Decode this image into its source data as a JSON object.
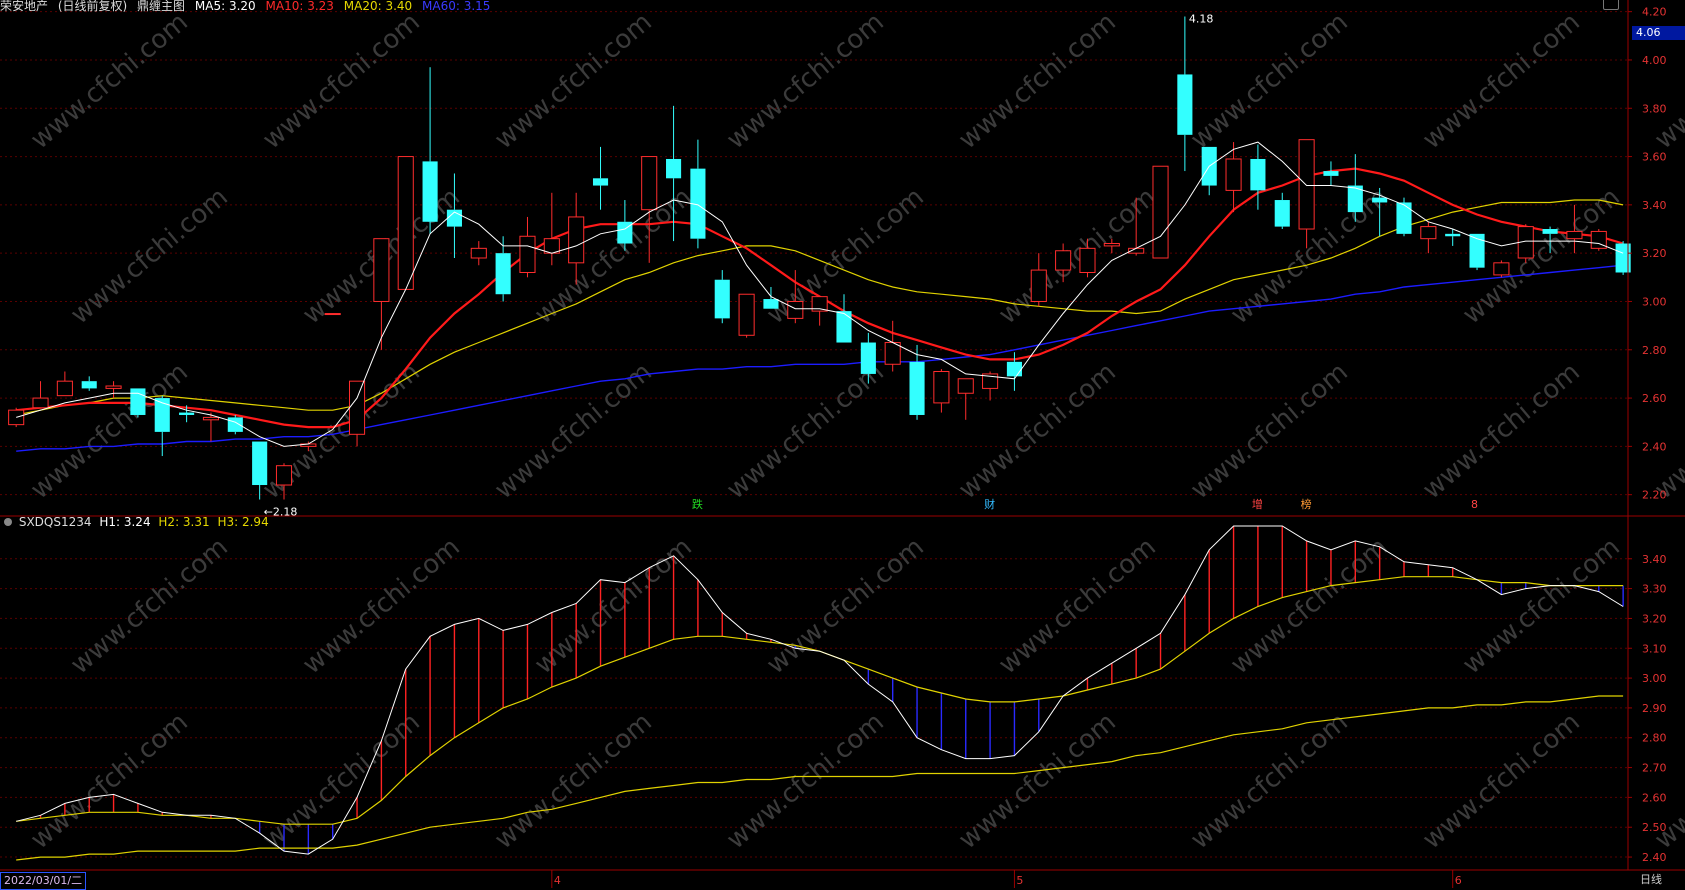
{
  "header": {
    "stock_name": "荣安地产",
    "adjust": "(日线前复权)",
    "indicator_name": "鼎缠主图",
    "ma5": "MA5: 3.20",
    "ma10": "MA10: 3.23",
    "ma20": "MA20: 3.40",
    "ma60": "MA60: 3.15"
  },
  "colors": {
    "up": "#ff2d2d",
    "down": "#33ffff",
    "ma5": "#ffffff",
    "ma10": "#ff1a1a",
    "ma20": "#e0d200",
    "ma60": "#1c1cff",
    "grid": "#5a0000",
    "axis": "#9b0000",
    "axis_text": "#e53333",
    "tag_bg": "#0018a0"
  },
  "price_tag": "4.06",
  "indicator": {
    "name": "SXDQS1234",
    "h1": "H1: 3.24",
    "h2": "H2: 3.31",
    "h3": "H3: 2.94"
  },
  "date_label": "2022/03/01/二",
  "period_label": "日线",
  "watermark": "www.cfchi.com",
  "chart_data": [
    {
      "type": "candlestick",
      "ylim": [
        2.12,
        4.24
      ],
      "yticks": [
        "2.20",
        "2.40",
        "2.60",
        "2.80",
        "3.00",
        "3.20",
        "3.40",
        "3.60",
        "3.80",
        "4.00",
        "4.20"
      ],
      "x_month_ticks": [
        {
          "index": 22,
          "label": "4"
        },
        {
          "index": 41,
          "label": "5"
        },
        {
          "index": 59,
          "label": "6"
        }
      ],
      "annotations": [
        {
          "index": 10,
          "price": 2.18,
          "text": "←2.18"
        },
        {
          "index": 48,
          "price": 4.18,
          "text": "4.18"
        }
      ],
      "event_markers": [
        {
          "index": 28,
          "text": "跌",
          "color": "#22dd22"
        },
        {
          "index": 40,
          "text": "财",
          "color": "#33bbff"
        },
        {
          "index": 51,
          "text": "增",
          "color": "#ff4444"
        },
        {
          "index": 53,
          "text": "榜",
          "color": "#ff9933"
        },
        {
          "index": 60,
          "text": "8",
          "color": "#ff4444"
        }
      ],
      "candles": [
        {
          "o": 2.49,
          "h": 2.56,
          "l": 2.48,
          "c": 2.55
        },
        {
          "o": 2.56,
          "h": 2.67,
          "l": 2.56,
          "c": 2.6
        },
        {
          "o": 2.61,
          "h": 2.71,
          "l": 2.61,
          "c": 2.67
        },
        {
          "o": 2.67,
          "h": 2.69,
          "l": 2.63,
          "c": 2.64
        },
        {
          "o": 2.64,
          "h": 2.67,
          "l": 2.6,
          "c": 2.65
        },
        {
          "o": 2.64,
          "h": 2.64,
          "l": 2.52,
          "c": 2.53
        },
        {
          "o": 2.6,
          "h": 2.61,
          "l": 2.36,
          "c": 2.46
        },
        {
          "o": 2.54,
          "h": 2.57,
          "l": 2.5,
          "c": 2.53
        },
        {
          "o": 2.51,
          "h": 2.54,
          "l": 2.42,
          "c": 2.52
        },
        {
          "o": 2.52,
          "h": 2.53,
          "l": 2.45,
          "c": 2.46
        },
        {
          "o": 2.42,
          "h": 2.42,
          "l": 2.18,
          "c": 2.24
        },
        {
          "o": 2.24,
          "h": 2.33,
          "l": 2.18,
          "c": 2.32
        },
        {
          "o": 2.4,
          "h": 2.42,
          "l": 2.38,
          "c": 2.41
        },
        {
          "o": 2.95,
          "h": 2.95,
          "l": 2.95,
          "c": 2.95
        },
        {
          "o": 2.45,
          "h": 2.67,
          "l": 2.4,
          "c": 2.67
        },
        {
          "o": 3.0,
          "h": 3.26,
          "l": 2.8,
          "c": 3.26
        },
        {
          "o": 3.05,
          "h": 3.6,
          "l": 3.05,
          "c": 3.6
        },
        {
          "o": 3.58,
          "h": 3.97,
          "l": 3.28,
          "c": 3.33
        },
        {
          "o": 3.38,
          "h": 3.53,
          "l": 3.18,
          "c": 3.31
        },
        {
          "o": 3.18,
          "h": 3.25,
          "l": 3.15,
          "c": 3.22
        },
        {
          "o": 3.2,
          "h": 3.27,
          "l": 3.0,
          "c": 3.03
        },
        {
          "o": 3.12,
          "h": 3.35,
          "l": 3.1,
          "c": 3.27
        },
        {
          "o": 3.2,
          "h": 3.45,
          "l": 3.15,
          "c": 3.26
        },
        {
          "o": 3.16,
          "h": 3.45,
          "l": 3.07,
          "c": 3.35
        },
        {
          "o": 3.51,
          "h": 3.64,
          "l": 3.38,
          "c": 3.48
        },
        {
          "o": 3.33,
          "h": 3.42,
          "l": 3.21,
          "c": 3.24
        },
        {
          "o": 3.38,
          "h": 3.6,
          "l": 3.16,
          "c": 3.6
        },
        {
          "o": 3.59,
          "h": 3.81,
          "l": 3.25,
          "c": 3.51
        },
        {
          "o": 3.55,
          "h": 3.67,
          "l": 3.22,
          "c": 3.26
        },
        {
          "o": 3.09,
          "h": 3.13,
          "l": 2.91,
          "c": 2.93
        },
        {
          "o": 2.86,
          "h": 3.03,
          "l": 2.85,
          "c": 3.03
        },
        {
          "o": 3.01,
          "h": 3.06,
          "l": 2.97,
          "c": 2.97
        },
        {
          "o": 2.93,
          "h": 3.13,
          "l": 2.91,
          "c": 3.0
        },
        {
          "o": 2.96,
          "h": 3.02,
          "l": 2.9,
          "c": 3.02
        },
        {
          "o": 2.96,
          "h": 3.03,
          "l": 2.83,
          "c": 2.83
        },
        {
          "o": 2.83,
          "h": 2.87,
          "l": 2.66,
          "c": 2.7
        },
        {
          "o": 2.74,
          "h": 2.92,
          "l": 2.71,
          "c": 2.83
        },
        {
          "o": 2.75,
          "h": 2.82,
          "l": 2.51,
          "c": 2.53
        },
        {
          "o": 2.58,
          "h": 2.72,
          "l": 2.54,
          "c": 2.71
        },
        {
          "o": 2.62,
          "h": 2.68,
          "l": 2.51,
          "c": 2.68
        },
        {
          "o": 2.64,
          "h": 2.71,
          "l": 2.59,
          "c": 2.7
        },
        {
          "o": 2.75,
          "h": 2.79,
          "l": 2.63,
          "c": 2.69
        },
        {
          "o": 3.0,
          "h": 3.2,
          "l": 2.98,
          "c": 3.13
        },
        {
          "o": 3.13,
          "h": 3.24,
          "l": 3.08,
          "c": 3.21
        },
        {
          "o": 3.12,
          "h": 3.26,
          "l": 3.1,
          "c": 3.22
        },
        {
          "o": 3.23,
          "h": 3.26,
          "l": 3.2,
          "c": 3.24
        },
        {
          "o": 3.2,
          "h": 3.43,
          "l": 3.19,
          "c": 3.22
        },
        {
          "o": 3.18,
          "h": 3.56,
          "l": 3.18,
          "c": 3.56
        },
        {
          "o": 3.94,
          "h": 4.18,
          "l": 3.54,
          "c": 3.69
        },
        {
          "o": 3.64,
          "h": 3.58,
          "l": 3.44,
          "c": 3.48
        },
        {
          "o": 3.46,
          "h": 3.66,
          "l": 3.37,
          "c": 3.59
        },
        {
          "o": 3.59,
          "h": 3.65,
          "l": 3.38,
          "c": 3.46
        },
        {
          "o": 3.42,
          "h": 3.45,
          "l": 3.3,
          "c": 3.31
        },
        {
          "o": 3.3,
          "h": 3.67,
          "l": 3.22,
          "c": 3.67
        },
        {
          "o": 3.54,
          "h": 3.58,
          "l": 3.48,
          "c": 3.52
        },
        {
          "o": 3.48,
          "h": 3.61,
          "l": 3.33,
          "c": 3.37
        },
        {
          "o": 3.43,
          "h": 3.47,
          "l": 3.27,
          "c": 3.41
        },
        {
          "o": 3.41,
          "h": 3.43,
          "l": 3.27,
          "c": 3.28
        },
        {
          "o": 3.26,
          "h": 3.33,
          "l": 3.2,
          "c": 3.31
        },
        {
          "o": 3.28,
          "h": 3.3,
          "l": 3.23,
          "c": 3.27
        },
        {
          "o": 3.28,
          "h": 3.28,
          "l": 3.13,
          "c": 3.14
        },
        {
          "o": 3.11,
          "h": 3.17,
          "l": 3.1,
          "c": 3.16
        },
        {
          "o": 3.18,
          "h": 3.32,
          "l": 3.16,
          "c": 3.31
        },
        {
          "o": 3.3,
          "h": 3.31,
          "l": 3.2,
          "c": 3.28
        },
        {
          "o": 3.26,
          "h": 3.4,
          "l": 3.2,
          "c": 3.29
        },
        {
          "o": 3.22,
          "h": 3.3,
          "l": 3.21,
          "c": 3.29
        },
        {
          "o": 3.24,
          "h": 3.25,
          "l": 3.11,
          "c": 3.12
        }
      ],
      "series": [
        {
          "name": "MA5",
          "color": "#ffffff",
          "values": [
            2.52,
            2.55,
            2.58,
            2.6,
            2.62,
            2.62,
            2.58,
            2.55,
            2.53,
            2.5,
            2.44,
            2.4,
            2.41,
            2.47,
            2.6,
            2.85,
            3.05,
            3.28,
            3.37,
            3.32,
            3.23,
            3.23,
            3.2,
            3.23,
            3.28,
            3.3,
            3.37,
            3.42,
            3.4,
            3.33,
            3.15,
            3.02,
            2.97,
            2.97,
            2.95,
            2.88,
            2.83,
            2.78,
            2.76,
            2.7,
            2.69,
            2.68,
            2.82,
            2.95,
            3.07,
            3.17,
            3.22,
            3.27,
            3.4,
            3.56,
            3.63,
            3.66,
            3.58,
            3.48,
            3.48,
            3.47,
            3.44,
            3.4,
            3.33,
            3.3,
            3.26,
            3.23,
            3.25,
            3.25,
            3.25,
            3.24,
            3.2
          ]
        },
        {
          "name": "MA10",
          "color": "#ff1a1a",
          "values": [
            2.55,
            2.56,
            2.57,
            2.58,
            2.58,
            2.58,
            2.57,
            2.56,
            2.55,
            2.53,
            2.51,
            2.49,
            2.48,
            2.48,
            2.51,
            2.6,
            2.72,
            2.85,
            2.95,
            3.03,
            3.12,
            3.2,
            3.26,
            3.3,
            3.32,
            3.32,
            3.32,
            3.33,
            3.32,
            3.27,
            3.22,
            3.15,
            3.08,
            3.02,
            2.96,
            2.91,
            2.87,
            2.84,
            2.81,
            2.78,
            2.76,
            2.76,
            2.78,
            2.82,
            2.87,
            2.94,
            3.0,
            3.05,
            3.15,
            3.27,
            3.38,
            3.45,
            3.48,
            3.52,
            3.54,
            3.55,
            3.53,
            3.5,
            3.45,
            3.4,
            3.36,
            3.33,
            3.31,
            3.29,
            3.28,
            3.27,
            3.24
          ]
        },
        {
          "name": "MA20",
          "color": "#e0d200",
          "values": [
            2.53,
            2.55,
            2.57,
            2.58,
            2.6,
            2.6,
            2.61,
            2.6,
            2.59,
            2.58,
            2.57,
            2.56,
            2.55,
            2.55,
            2.57,
            2.62,
            2.68,
            2.74,
            2.79,
            2.83,
            2.87,
            2.91,
            2.95,
            2.99,
            3.04,
            3.09,
            3.12,
            3.16,
            3.19,
            3.21,
            3.23,
            3.23,
            3.21,
            3.17,
            3.13,
            3.09,
            3.06,
            3.04,
            3.03,
            3.02,
            3.01,
            2.99,
            2.98,
            2.97,
            2.96,
            2.96,
            2.95,
            2.96,
            3.01,
            3.05,
            3.09,
            3.11,
            3.13,
            3.15,
            3.18,
            3.22,
            3.27,
            3.31,
            3.34,
            3.37,
            3.39,
            3.41,
            3.41,
            3.41,
            3.42,
            3.42,
            3.4
          ]
        },
        {
          "name": "MA60",
          "color": "#1c1cff",
          "values": [
            2.38,
            2.39,
            2.39,
            2.4,
            2.4,
            2.41,
            2.41,
            2.42,
            2.42,
            2.43,
            2.43,
            2.44,
            2.44,
            2.45,
            2.47,
            2.49,
            2.51,
            2.53,
            2.55,
            2.57,
            2.59,
            2.61,
            2.63,
            2.65,
            2.67,
            2.68,
            2.7,
            2.71,
            2.72,
            2.72,
            2.73,
            2.73,
            2.74,
            2.74,
            2.74,
            2.75,
            2.75,
            2.75,
            2.76,
            2.77,
            2.78,
            2.8,
            2.82,
            2.84,
            2.86,
            2.88,
            2.9,
            2.92,
            2.94,
            2.96,
            2.97,
            2.98,
            2.99,
            3.0,
            3.01,
            3.03,
            3.04,
            3.06,
            3.07,
            3.08,
            3.09,
            3.1,
            3.11,
            3.12,
            3.13,
            3.14,
            3.15
          ]
        }
      ]
    },
    {
      "type": "line",
      "name": "SXDQS1234",
      "ylim": [
        2.37,
        3.53
      ],
      "yticks": [
        "2.40",
        "2.50",
        "2.60",
        "2.70",
        "2.80",
        "2.90",
        "3.00",
        "3.10",
        "3.20",
        "3.30",
        "3.40"
      ],
      "series": [
        {
          "name": "H1",
          "color": "#ffffff",
          "values": [
            2.52,
            2.54,
            2.58,
            2.6,
            2.61,
            2.58,
            2.55,
            2.54,
            2.54,
            2.53,
            2.48,
            2.42,
            2.41,
            2.46,
            2.6,
            2.79,
            3.03,
            3.14,
            3.18,
            3.2,
            3.16,
            3.18,
            3.22,
            3.25,
            3.33,
            3.32,
            3.37,
            3.41,
            3.33,
            3.22,
            3.15,
            3.13,
            3.1,
            3.09,
            3.06,
            2.98,
            2.92,
            2.8,
            2.76,
            2.73,
            2.73,
            2.74,
            2.82,
            2.94,
            3.0,
            3.05,
            3.1,
            3.15,
            3.28,
            3.43,
            3.51,
            3.51,
            3.51,
            3.46,
            3.43,
            3.46,
            3.44,
            3.39,
            3.38,
            3.37,
            3.33,
            3.28,
            3.3,
            3.31,
            3.31,
            3.29,
            3.24
          ]
        },
        {
          "name": "H2",
          "color": "#e0d200",
          "values": [
            2.52,
            2.53,
            2.54,
            2.55,
            2.55,
            2.55,
            2.54,
            2.54,
            2.53,
            2.53,
            2.52,
            2.51,
            2.51,
            2.51,
            2.53,
            2.59,
            2.67,
            2.74,
            2.8,
            2.85,
            2.9,
            2.93,
            2.97,
            3.0,
            3.04,
            3.07,
            3.1,
            3.13,
            3.14,
            3.14,
            3.13,
            3.12,
            3.11,
            3.09,
            3.06,
            3.03,
            3.0,
            2.97,
            2.95,
            2.93,
            2.92,
            2.92,
            2.93,
            2.94,
            2.96,
            2.98,
            3.0,
            3.03,
            3.09,
            3.15,
            3.2,
            3.24,
            3.27,
            3.29,
            3.31,
            3.32,
            3.33,
            3.34,
            3.34,
            3.34,
            3.33,
            3.32,
            3.32,
            3.31,
            3.31,
            3.31,
            3.31
          ]
        },
        {
          "name": "H3",
          "color": "#e0d200",
          "values": [
            2.39,
            2.4,
            2.4,
            2.41,
            2.41,
            2.42,
            2.42,
            2.42,
            2.42,
            2.42,
            2.43,
            2.43,
            2.43,
            2.43,
            2.44,
            2.46,
            2.48,
            2.5,
            2.51,
            2.52,
            2.53,
            2.55,
            2.56,
            2.58,
            2.6,
            2.62,
            2.63,
            2.64,
            2.65,
            2.65,
            2.66,
            2.66,
            2.67,
            2.67,
            2.67,
            2.67,
            2.67,
            2.68,
            2.68,
            2.68,
            2.68,
            2.68,
            2.69,
            2.7,
            2.71,
            2.72,
            2.74,
            2.75,
            2.77,
            2.79,
            2.81,
            2.82,
            2.83,
            2.85,
            2.86,
            2.87,
            2.88,
            2.89,
            2.9,
            2.9,
            2.91,
            2.91,
            2.92,
            2.92,
            2.93,
            2.94,
            2.94
          ]
        }
      ]
    }
  ]
}
